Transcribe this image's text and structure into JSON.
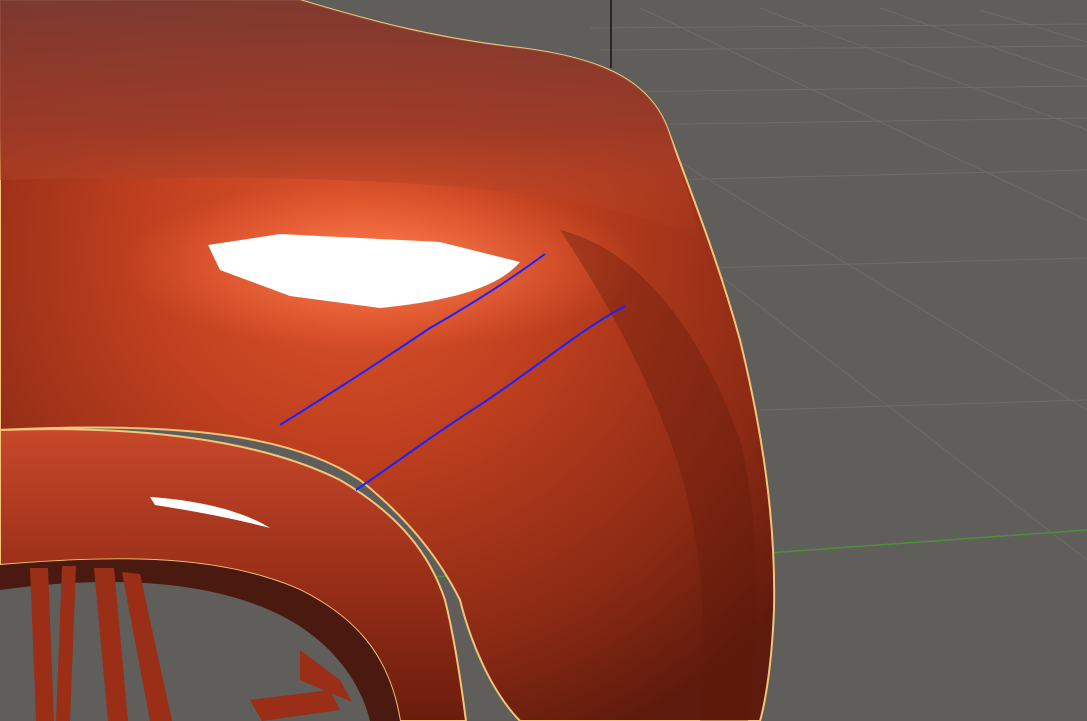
{
  "viewport": {
    "view": "3d-viewport-perspective",
    "background_color": "#5f5e5a",
    "grid_color": "#6d6c68",
    "x_axis_color": "#4f8f3a",
    "z_axis_color": "#141414",
    "selection_outline_color": "#f2c47a",
    "annotation_stroke_color": "#1a22ff"
  },
  "objects": [
    {
      "name": "car-fender",
      "material_color": "#b8391e",
      "selected": true
    },
    {
      "name": "wheel-arch",
      "material_color": "#a23018",
      "selected": true
    },
    {
      "name": "wheel-rim",
      "material_color": "#8f2a17",
      "selected": false
    }
  ],
  "annotations": [
    {
      "type": "grease-pencil-stroke",
      "color": "#1a22ff"
    },
    {
      "type": "grease-pencil-stroke",
      "color": "#1a22ff"
    }
  ]
}
